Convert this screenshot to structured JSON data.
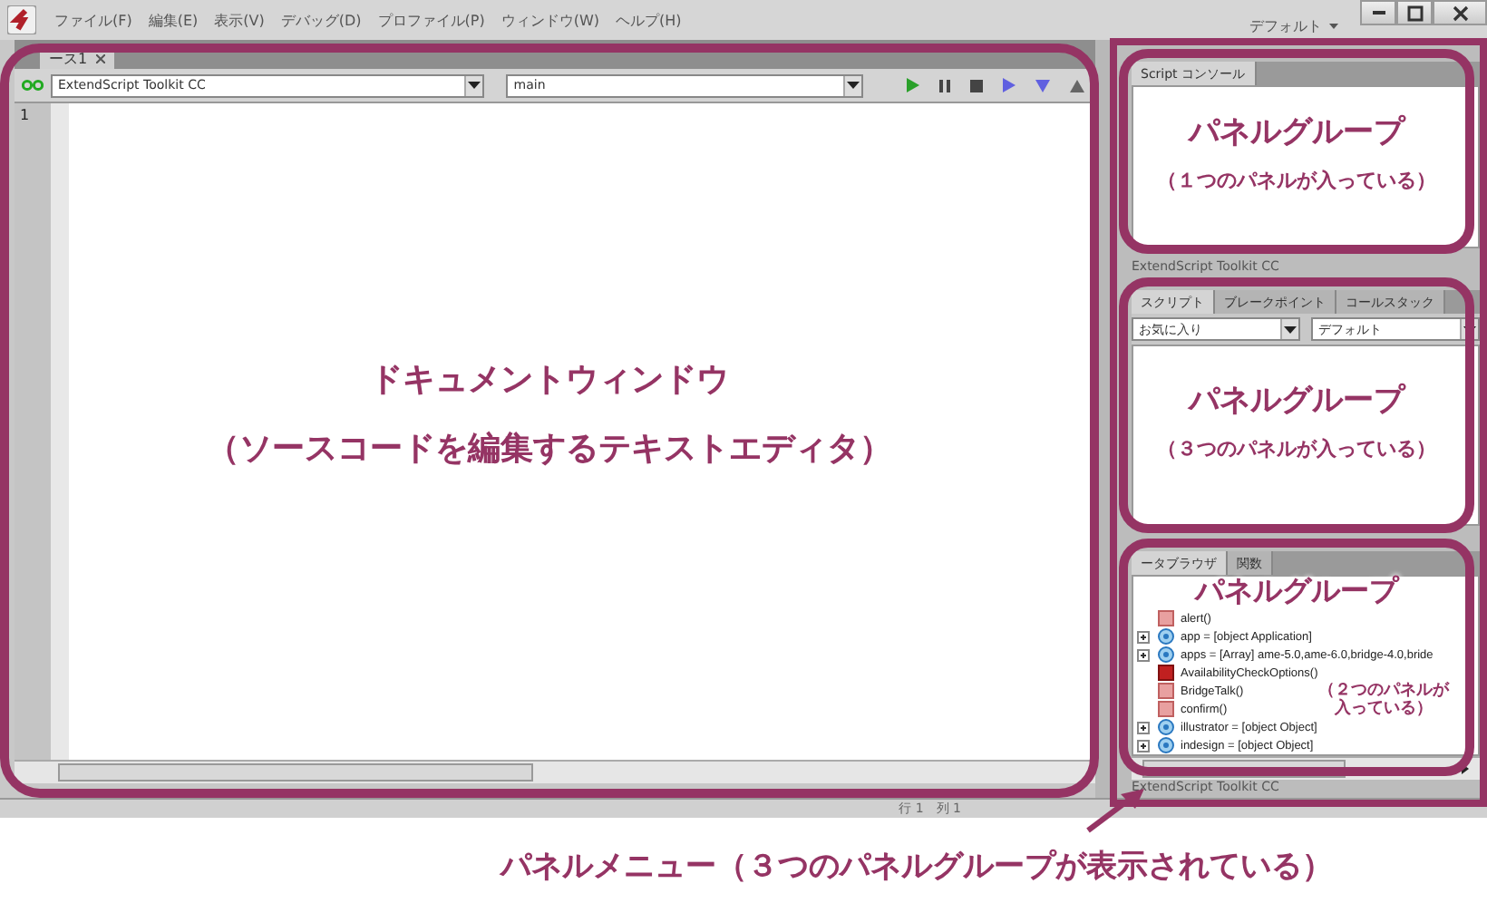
{
  "window": {
    "menu": [
      "ファイル(F)",
      "編集(E)",
      "表示(V)",
      "デバッグ(D)",
      "プロファイル(P)",
      "ウィンドウ(W)",
      "ヘルプ(H)"
    ],
    "workspace": "デフォルト"
  },
  "document": {
    "tabs": [
      {
        "label": "ース1",
        "selected": true
      }
    ],
    "target": "ExtendScript Toolkit CC",
    "function": "main",
    "line_numbers": [
      "1"
    ]
  },
  "console_panel": {
    "tabs": [
      {
        "label": "Script コンソール",
        "selected": true
      }
    ],
    "footer": "ExtendScript Toolkit CC"
  },
  "scripts_panel": {
    "tabs": [
      {
        "label": "スクリプト",
        "selected": true
      },
      {
        "label": "ブレークポイント",
        "selected": false
      },
      {
        "label": "コールスタック",
        "selected": false
      }
    ],
    "dropdowns": [
      "お気に入り",
      "デフォルト"
    ]
  },
  "data_panel": {
    "tabs": [
      {
        "label": "ータブラウザ",
        "selected": true
      },
      {
        "label": "関数",
        "selected": false
      }
    ],
    "items": [
      {
        "kind": "function",
        "text": "alert()",
        "expandable": false
      },
      {
        "kind": "object",
        "text": "app = [object Application]",
        "expandable": true
      },
      {
        "kind": "object",
        "text": "apps = [Array] ame-5.0,ame-6.0,bridge-4.0,bride",
        "expandable": true
      },
      {
        "kind": "class",
        "text": "AvailabilityCheckOptions()",
        "expandable": false
      },
      {
        "kind": "function",
        "text": "BridgeTalk()",
        "expandable": false
      },
      {
        "kind": "function",
        "text": "confirm()",
        "expandable": false
      },
      {
        "kind": "object",
        "text": "illustrator = [object Object]",
        "expandable": true
      },
      {
        "kind": "object",
        "text": "indesign = [object Object]",
        "expandable": true
      }
    ],
    "footer": "ExtendScript Toolkit CC"
  },
  "status_bar": {
    "position": "行 1　列 1"
  },
  "annotations": [
    {
      "title": "ドキュメントウィンドウ",
      "subtitle": "（ソースコードを編集するテキストエディタ）"
    },
    {
      "title": "パネルグループ",
      "subtitle": "（１つのパネルが入っている）"
    },
    {
      "title": "パネルグループ",
      "subtitle": "（３つのパネルが入っている）"
    },
    {
      "title": "パネルグループ",
      "subtitle": "（２つのパネルが入っている）"
    }
  ],
  "caption": "パネルメニュー（３つのパネルグループが表示されている）"
}
